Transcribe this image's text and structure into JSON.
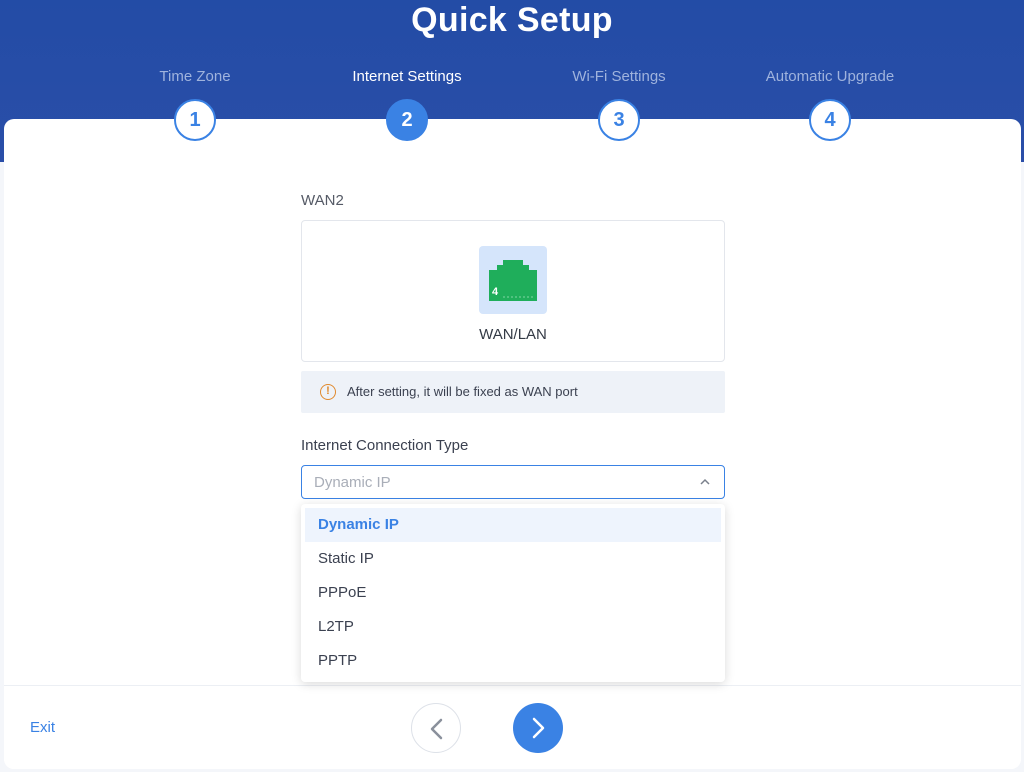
{
  "header": {
    "title": "Quick Setup"
  },
  "steps": [
    {
      "number": "1",
      "label": "Time Zone",
      "active": false
    },
    {
      "number": "2",
      "label": "Internet Settings",
      "active": true
    },
    {
      "number": "3",
      "label": "Wi-Fi Settings",
      "active": false
    },
    {
      "number": "4",
      "label": "Automatic Upgrade",
      "active": false
    }
  ],
  "wan": {
    "section_label": "WAN2",
    "port_number": "4",
    "port_label": "WAN/LAN",
    "port_icon": "ethernet-port-icon"
  },
  "notice": {
    "icon": "warning-circle-icon",
    "text": "After setting, it will be fixed as WAN port"
  },
  "connection": {
    "label": "Internet Connection Type",
    "selected_value": "Dynamic IP",
    "options": [
      "Dynamic IP",
      "Static IP",
      "PPPoE",
      "L2TP",
      "PPTP"
    ],
    "selected_index": 0
  },
  "footer": {
    "exit_label": "Exit",
    "prev_icon": "chevron-left-icon",
    "next_icon": "chevron-right-icon"
  },
  "colors": {
    "header_bg": "#2a4ea8",
    "accent": "#3a82e4",
    "warning": "#e08a2e",
    "port_green": "#1fae5b"
  }
}
